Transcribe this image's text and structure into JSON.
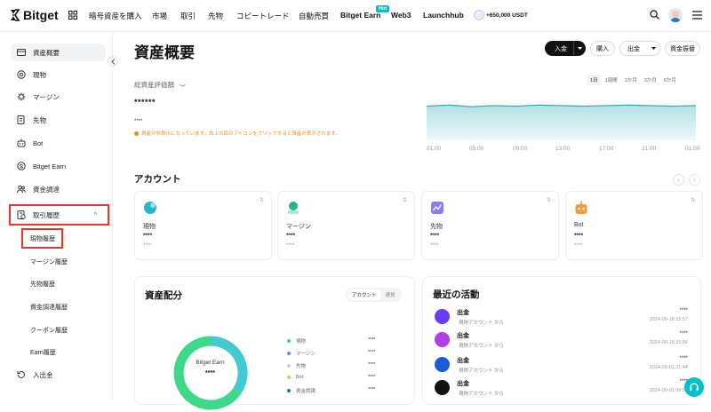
{
  "brand": {
    "name": "Bitget"
  },
  "nav": {
    "items": [
      "暗号資産を購入",
      "市場",
      "取引",
      "先物",
      "コピートレード",
      "自動売買",
      "Bitget Earn",
      "Web3",
      "Launchhub"
    ],
    "hot_badge": "Hot",
    "promo": "+650,000 USDT"
  },
  "sidebar": {
    "items": [
      "資産概要",
      "現物",
      "マージン",
      "先物",
      "Bot",
      "Bitget Earn",
      "資金調達",
      "取引履歴",
      "入出金"
    ],
    "subitems": [
      "現物履歴",
      "マージン履歴",
      "先物履歴",
      "資金調達履歴",
      "クーポン履歴",
      "Earn履歴"
    ],
    "expand_glyph": "^"
  },
  "page": {
    "title": "資産概要",
    "deposit_label": "入金",
    "buy_label": "購入",
    "withdraw_label": "出金",
    "transfer_label": "資金振替",
    "total_label": "総資産評価額",
    "hidden_value": "******",
    "hidden_small": "****",
    "notice": "資産が非表示になっています。右上の目のアイコンをクリックすると資産が表示されます。"
  },
  "timeframes": [
    "1日",
    "1週間",
    "1か月",
    "3か月",
    "6か月"
  ],
  "chart_data": {
    "type": "area",
    "x": [
      "01:00",
      "05:00",
      "09:00",
      "13:00",
      "17:00",
      "21:00",
      "01:00"
    ],
    "series": [
      {
        "values": [
          0.62,
          0.64,
          0.61,
          0.63,
          0.62,
          0.64,
          0.63,
          0.62,
          0.63,
          0.64,
          0.63,
          0.62,
          0.63
        ]
      }
    ],
    "ylim": [
      0,
      1
    ],
    "grid": false,
    "color": "#23a8b5"
  },
  "accounts": {
    "title": "アカウント",
    "prev": "‹",
    "next": "›",
    "cards": [
      {
        "name": "現物",
        "value": "****",
        "sub": "****",
        "more": "⇅"
      },
      {
        "name": "マージン",
        "value": "****",
        "sub": "****",
        "more": "⇅"
      },
      {
        "name": "先物",
        "value": "****",
        "sub": "****",
        "more": "⇅"
      },
      {
        "name": "Bot",
        "value": "****",
        "sub": "****",
        "more": "⇅"
      }
    ]
  },
  "allocation": {
    "title": "資産配分",
    "tabs": [
      "アカウント",
      "通貨"
    ],
    "donut_label": "Bitget Earn",
    "donut_value": "****",
    "legend": [
      {
        "name": "現物",
        "value": "****",
        "color": "#3ec8a8"
      },
      {
        "name": "マージン",
        "value": "****",
        "color": "#5b8def"
      },
      {
        "name": "先物",
        "value": "****",
        "color": "#c9cdd4"
      },
      {
        "name": "Bot",
        "value": "****",
        "color": "#9be27a"
      },
      {
        "name": "資金調達",
        "value": "****",
        "color": "#1f8a4c"
      }
    ]
  },
  "activity": {
    "title": "最近の活動",
    "items": [
      {
        "title": "出金",
        "desc": "現物アカウント から",
        "value": "****",
        "time": "2024-09-18 15:57",
        "color": "#6a3df0"
      },
      {
        "title": "出金",
        "desc": "現物アカウント から",
        "value": "****",
        "time": "2024-09-18 15:56",
        "color": "#b13ee0"
      },
      {
        "title": "出金",
        "desc": "現物アカウント から",
        "value": "****",
        "time": "2024-09-01 21:44",
        "color": "#1e5bd6"
      },
      {
        "title": "出金",
        "desc": "現物アカウント から",
        "value": "****",
        "time": "2024-09-01 09:53",
        "color": "#111111"
      }
    ]
  },
  "colors": {
    "accent": "#00c0c9",
    "highlight": "#e8362b",
    "warning": "#f08b12"
  }
}
